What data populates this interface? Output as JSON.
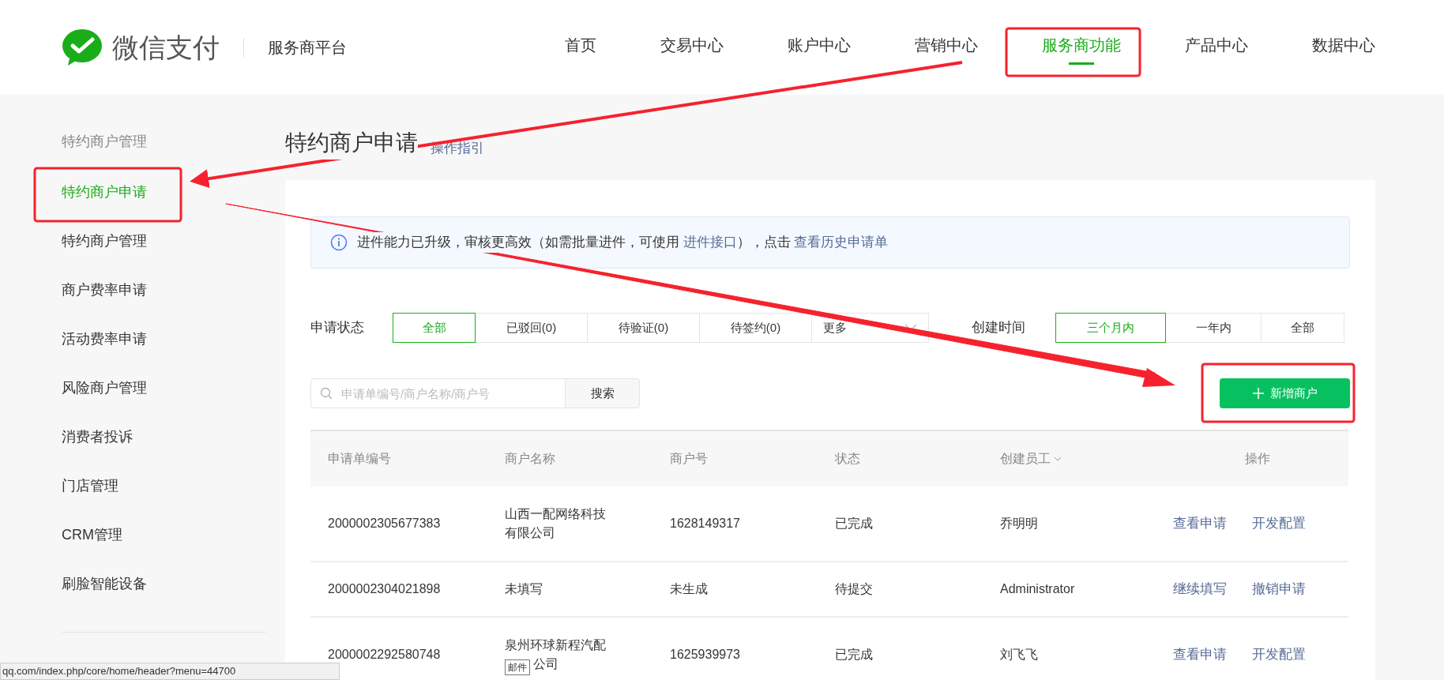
{
  "header": {
    "logo_text": "微信支付",
    "platform": "服务商平台",
    "nav": [
      {
        "label": "首页",
        "selected": false
      },
      {
        "label": "交易中心",
        "selected": false
      },
      {
        "label": "账户中心",
        "selected": false
      },
      {
        "label": "营销中心",
        "selected": false
      },
      {
        "label": "服务商功能",
        "selected": true
      },
      {
        "label": "产品中心",
        "selected": false
      },
      {
        "label": "数据中心",
        "selected": false
      }
    ]
  },
  "sidebar": {
    "group_title": "特约商户管理",
    "items": [
      {
        "label": "特约商户申请",
        "selected": true
      },
      {
        "label": "特约商户管理",
        "selected": false
      },
      {
        "label": "商户费率申请",
        "selected": false
      },
      {
        "label": "活动费率申请",
        "selected": false
      },
      {
        "label": "风险商户管理",
        "selected": false
      },
      {
        "label": "消费者投诉",
        "selected": false
      },
      {
        "label": "门店管理",
        "selected": false
      },
      {
        "label": "CRM管理",
        "selected": false
      },
      {
        "label": "刷脸智能设备",
        "selected": false
      }
    ]
  },
  "page": {
    "title": "特约商户申请",
    "guide_link": "操作指引"
  },
  "notice": [
    {
      "kind": "text",
      "text": "进件能力已升级，审核更高效（如需批量进件，可使用 "
    },
    {
      "kind": "link",
      "text": "进件接口"
    },
    {
      "kind": "text",
      "text": "），点击 "
    },
    {
      "kind": "link",
      "text": "查看历史申请单"
    }
  ],
  "status_filter": {
    "label": "申请状态",
    "options": [
      {
        "label": "全部",
        "selected": true
      },
      {
        "label": "已驳回(0)",
        "selected": false
      },
      {
        "label": "待验证(0)",
        "selected": false
      },
      {
        "label": "待签约(0)",
        "selected": false
      }
    ],
    "more": "更多"
  },
  "time_filter": {
    "label": "创建时间",
    "options": [
      {
        "label": "三个月内",
        "selected": true
      },
      {
        "label": "一年内",
        "selected": false
      },
      {
        "label": "全部",
        "selected": false
      }
    ]
  },
  "search": {
    "placeholder": "申请单编号/商户名称/商户号",
    "button": "搜索"
  },
  "add_button": "新增商户",
  "table": {
    "columns": [
      "申请单编号",
      "商户名称",
      "商户号",
      "状态",
      "创建员工",
      "操作"
    ],
    "rows": [
      {
        "id": "2000002305677383",
        "name_lines": [
          "山西一配网络科技",
          "有限公司"
        ],
        "merchant_no": "1628149317",
        "status": "已完成",
        "creator": "乔明明",
        "actions": [
          "查看申请",
          "开发配置"
        ]
      },
      {
        "id": "2000002304021898",
        "name_lines": [
          "未填写"
        ],
        "merchant_no": "未生成",
        "status": "待提交",
        "creator": "Administrator",
        "actions": [
          "继续填写",
          "撤销申请"
        ]
      },
      {
        "id": "2000002292580748",
        "name_lines": [
          "泉州环球新程汽配",
          "公司"
        ],
        "merchant_no": "1625939973",
        "status": "已完成",
        "creator": "刘飞飞",
        "actions": [
          "查看申请",
          "开发配置"
        ],
        "tooltip": "邮件"
      }
    ]
  },
  "status_bar": "qq.com/index.php/core/home/header?menu=44700"
}
